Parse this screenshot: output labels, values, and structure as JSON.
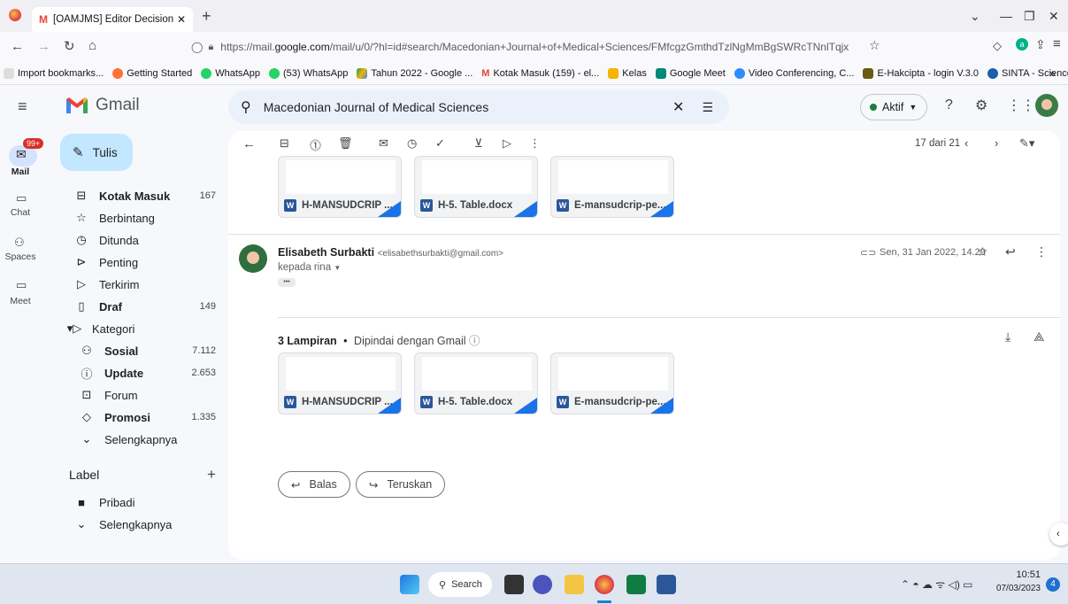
{
  "browser": {
    "tab_title": "[OAMJMS] Editor Decision - elis",
    "url_prefix": "https://mail.",
    "url_domain": "google.com",
    "url_rest": "/mail/u/0/?hl=id#search/Macedonian+Journal+of+Medical+Sciences/FMfcgzGmthdTzlNgMmBgSWRcTNnlTqjx",
    "bookmarks": [
      "Import bookmarks...",
      "Getting Started",
      "WhatsApp",
      "(53) WhatsApp",
      "Tahun 2022 - Google ...",
      "Kotak Masuk (159) - el...",
      "Kelas",
      "Google Meet",
      "Video Conferencing, C...",
      "E-Hakcipta - login V.3.0",
      "SINTA - Science and T..."
    ]
  },
  "gmail": {
    "logo_text": "Gmail",
    "compose_label": "Tulis",
    "mail_badge": "99+",
    "rail": {
      "mail": "Mail",
      "chat": "Chat",
      "spaces": "Spaces",
      "meet": "Meet"
    },
    "search_value": "Macedonian Journal of Medical Sciences",
    "status_label": "Aktif",
    "nav": [
      {
        "label": "Kotak Masuk",
        "count": "167"
      },
      {
        "label": "Berbintang",
        "count": ""
      },
      {
        "label": "Ditunda",
        "count": ""
      },
      {
        "label": "Penting",
        "count": ""
      },
      {
        "label": "Terkirim",
        "count": ""
      },
      {
        "label": "Draf",
        "count": "149"
      },
      {
        "label": "Kategori",
        "count": ""
      },
      {
        "label": "Sosial",
        "count": "7.112"
      },
      {
        "label": "Update",
        "count": "2.653"
      },
      {
        "label": "Forum",
        "count": ""
      },
      {
        "label": "Promosi",
        "count": "1.335"
      },
      {
        "label": "Selengkapnya",
        "count": ""
      }
    ],
    "label_header": "Label",
    "labels": [
      "Pribadi",
      "Selengkapnya"
    ],
    "pagination": "17 dari 21",
    "prev_attachments": [
      "H-MANSUDCRIP ...",
      "H-5. Table.docx",
      "E-mansudcrip-pe..."
    ],
    "message": {
      "sender_name": "Elisabeth Surbakti",
      "sender_email": "<elisabethsurbakti@gmail.com>",
      "to": "kepada rina",
      "date": "Sen, 31 Jan 2022, 14.29",
      "ellipsis": "•••",
      "attachment_count": "3 Lampiran",
      "scan_note": "Dipindai dengan Gmail",
      "attachments": [
        "H-MANSUDCRIP ...",
        "H-5. Table.docx",
        "E-mansudcrip-pe..."
      ]
    },
    "reply_label": "Balas",
    "forward_label": "Teruskan"
  },
  "taskbar": {
    "search_label": "Search",
    "time": "10:51",
    "date": "07/03/2023",
    "notification_count": "4"
  }
}
